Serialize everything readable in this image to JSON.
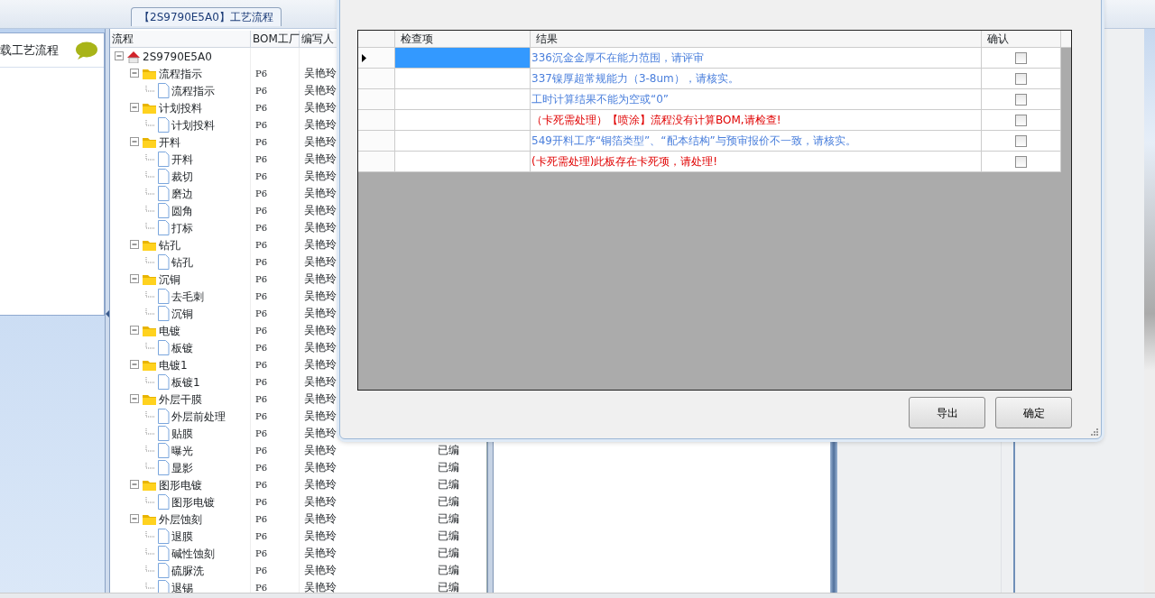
{
  "app": {
    "tab_title": "【2S9790E5A0】工艺流程",
    "left_panel": {
      "title": "载工艺流程"
    }
  },
  "process_grid": {
    "columns": [
      "流程",
      "BOM工厂",
      "编写人"
    ],
    "tree": [
      {
        "label": "2S9790E5A0",
        "kind": "root",
        "expanded": true,
        "children": [
          {
            "label": "流程指示",
            "kind": "folder",
            "bom_factory": "P6",
            "writer": "吴艳玲",
            "expanded": true,
            "children": [
              {
                "label": "流程指示",
                "kind": "doc",
                "bom_factory": "P6",
                "writer": "吴艳玲"
              }
            ]
          },
          {
            "label": "计划投料",
            "kind": "folder",
            "bom_factory": "P6",
            "writer": "吴艳玲",
            "expanded": true,
            "children": [
              {
                "label": "计划投料",
                "kind": "doc",
                "bom_factory": "P6",
                "writer": "吴艳玲"
              }
            ]
          },
          {
            "label": "开料",
            "kind": "folder",
            "bom_factory": "P6",
            "writer": "吴艳玲",
            "expanded": true,
            "children": [
              {
                "label": "开料",
                "kind": "doc",
                "bom_factory": "P6",
                "writer": "吴艳玲"
              },
              {
                "label": "裁切",
                "kind": "doc",
                "bom_factory": "P6",
                "writer": "吴艳玲"
              },
              {
                "label": "磨边",
                "kind": "doc",
                "bom_factory": "P6",
                "writer": "吴艳玲"
              },
              {
                "label": "圆角",
                "kind": "doc",
                "bom_factory": "P6",
                "writer": "吴艳玲"
              },
              {
                "label": "打标",
                "kind": "doc",
                "bom_factory": "P6",
                "writer": "吴艳玲"
              }
            ]
          },
          {
            "label": "钻孔",
            "kind": "folder",
            "bom_factory": "P6",
            "writer": "吴艳玲",
            "expanded": true,
            "children": [
              {
                "label": "钻孔",
                "kind": "doc",
                "bom_factory": "P6",
                "writer": "吴艳玲"
              }
            ]
          },
          {
            "label": "沉铜",
            "kind": "folder",
            "bom_factory": "P6",
            "writer": "吴艳玲",
            "expanded": true,
            "children": [
              {
                "label": "去毛刺",
                "kind": "doc",
                "bom_factory": "P6",
                "writer": "吴艳玲"
              },
              {
                "label": "沉铜",
                "kind": "doc",
                "bom_factory": "P6",
                "writer": "吴艳玲"
              }
            ]
          },
          {
            "label": "电镀",
            "kind": "folder",
            "bom_factory": "P6",
            "writer": "吴艳玲",
            "expanded": true,
            "children": [
              {
                "label": "板镀",
                "kind": "doc",
                "bom_factory": "P6",
                "writer": "吴艳玲"
              }
            ]
          },
          {
            "label": "电镀1",
            "kind": "folder",
            "bom_factory": "P6",
            "writer": "吴艳玲",
            "expanded": true,
            "children": [
              {
                "label": "板镀1",
                "kind": "doc",
                "bom_factory": "P6",
                "writer": "吴艳玲"
              }
            ]
          },
          {
            "label": "外层干膜",
            "kind": "folder",
            "bom_factory": "P6",
            "writer": "吴艳玲",
            "expanded": true,
            "children": [
              {
                "label": "外层前处理",
                "kind": "doc",
                "bom_factory": "P6",
                "writer": "吴艳玲"
              },
              {
                "label": "贴膜",
                "kind": "doc",
                "bom_factory": "P6",
                "writer": "吴艳玲"
              },
              {
                "label": "曝光",
                "kind": "doc",
                "bom_factory": "P6",
                "writer": "吴艳玲",
                "status": "已编"
              },
              {
                "label": "显影",
                "kind": "doc",
                "bom_factory": "P6",
                "writer": "吴艳玲",
                "status": "已编"
              }
            ]
          },
          {
            "label": "图形电镀",
            "kind": "folder",
            "bom_factory": "P6",
            "writer": "吴艳玲",
            "status": "已编",
            "expanded": true,
            "children": [
              {
                "label": "图形电镀",
                "kind": "doc",
                "bom_factory": "P6",
                "writer": "吴艳玲",
                "status": "已编"
              }
            ]
          },
          {
            "label": "外层蚀刻",
            "kind": "folder",
            "bom_factory": "P6",
            "writer": "吴艳玲",
            "status": "已编",
            "expanded": true,
            "children": [
              {
                "label": "退膜",
                "kind": "doc",
                "bom_factory": "P6",
                "writer": "吴艳玲",
                "status": "已编"
              },
              {
                "label": "碱性蚀刻",
                "kind": "doc",
                "bom_factory": "P6",
                "writer": "吴艳玲",
                "status": "已编"
              },
              {
                "label": "硫脲洗",
                "kind": "doc",
                "bom_factory": "P6",
                "writer": "吴艳玲",
                "status": "已编"
              },
              {
                "label": "退锡",
                "kind": "doc",
                "bom_factory": "P6",
                "writer": "吴艳玲",
                "status": "已编"
              }
            ]
          }
        ]
      }
    ]
  },
  "check_dialog": {
    "columns": [
      "检查项",
      "结果",
      "确认"
    ],
    "rows": [
      {
        "selected": true,
        "result": "336沉金金厚不在能力范围，请评审",
        "color": "#4a7fdc",
        "checked": false
      },
      {
        "selected": false,
        "result": "337镍厚超常规能力（3-8um），请核实。",
        "color": "#4a7fdc",
        "checked": false
      },
      {
        "selected": false,
        "result": "工时计算结果不能为空或“0”",
        "color": "#4a7fdc",
        "checked": false
      },
      {
        "selected": false,
        "result": "（卡死需处理）【喷涂】流程没有计算BOM,请检查!",
        "color": "#e00000",
        "checked": false
      },
      {
        "selected": false,
        "result": "549开料工序“铜箔类型”、“配本结构”与预审报价不一致，请核实。",
        "color": "#4a7fdc",
        "checked": false
      },
      {
        "selected": false,
        "result": "(卡死需处理)此板存在卡死项，请处理!",
        "color": "#e00000",
        "checked": false
      }
    ],
    "buttons": [
      "导出",
      "确定"
    ]
  }
}
